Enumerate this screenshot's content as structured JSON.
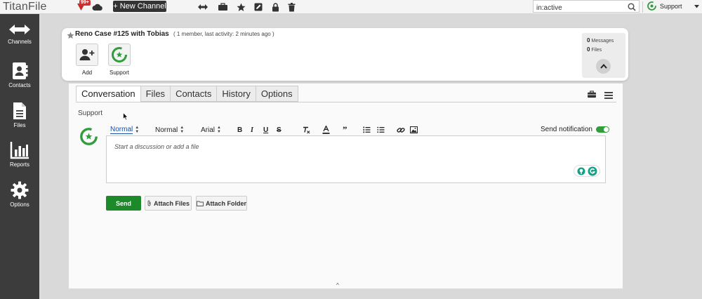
{
  "app": {
    "logo": "TitanFile"
  },
  "topbar": {
    "badge_count": "99+",
    "new_channel_label": "+ New Channel",
    "search_value": "in:active",
    "user_label": "Support"
  },
  "sidebar": {
    "items": [
      {
        "label": "Channels",
        "icon": "arrows-icon"
      },
      {
        "label": "Contacts",
        "icon": "contacts-icon"
      },
      {
        "label": "Files",
        "icon": "file-icon"
      },
      {
        "label": "Reports",
        "icon": "bar-chart-icon"
      },
      {
        "label": "Options",
        "icon": "gear-icon"
      }
    ]
  },
  "channel": {
    "title": "Reno Case #125 with Tobias",
    "meta": "( 1 member, last activity: 2 minutes ago )",
    "add_label": "Add",
    "member_label": "Support",
    "messages_count": "0",
    "messages_label": "Messages",
    "files_count": "0",
    "files_label": "Files"
  },
  "tabs": [
    {
      "label": "Conversation",
      "active": true
    },
    {
      "label": "Files",
      "active": false
    },
    {
      "label": "Contacts",
      "active": false
    },
    {
      "label": "History",
      "active": false
    },
    {
      "label": "Options",
      "active": false
    }
  ],
  "composer": {
    "recipient_label": "Support",
    "toolbar": {
      "heading_select": "Normal",
      "size_select": "Normal",
      "font_select": "Arial"
    },
    "notify_label": "Send notification",
    "notify_on": true,
    "placeholder": "Start a discussion or add a file",
    "send_label": "Send",
    "attach_files_label": "Attach Files",
    "attach_folder_label": "Attach Folder"
  },
  "colors": {
    "accent_green": "#1d8a2a",
    "sidebar_bg": "#3c3c3c",
    "link_blue": "#1b4fa0"
  }
}
